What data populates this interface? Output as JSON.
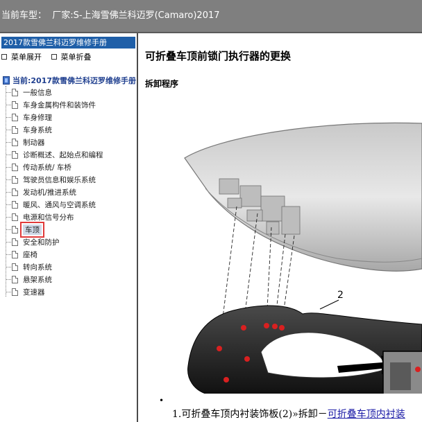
{
  "header": {
    "vehicle_label": "当前车型：",
    "vehicle_value": "厂家:S-上海雪佛兰科迈罗(Camaro)2017"
  },
  "sidebar": {
    "manual_title": "2017款雪佛兰科迈罗维修手册",
    "expand_label": "菜单展开",
    "collapse_label": "菜单折叠",
    "current_label": "当前:2017款雪佛兰科迈罗维修手册",
    "items": [
      {
        "label": "一般信息"
      },
      {
        "label": "车身金属构件和装饰件"
      },
      {
        "label": "车身修理"
      },
      {
        "label": "车身系统"
      },
      {
        "label": "制动器"
      },
      {
        "label": "诊断概述、起始点和编程"
      },
      {
        "label": "传动系统/ 车桥"
      },
      {
        "label": "驾驶员信息和娱乐系统"
      },
      {
        "label": "发动机/推进系统"
      },
      {
        "label": "暖风、通风与空调系统"
      },
      {
        "label": "电源和信号分布"
      },
      {
        "label": "车顶"
      },
      {
        "label": "安全和防护"
      },
      {
        "label": "座椅"
      },
      {
        "label": "转向系统"
      },
      {
        "label": "悬架系统"
      },
      {
        "label": "变速器"
      }
    ],
    "selected_index": 11
  },
  "content": {
    "title": "可折叠车顶前锁门执行器的更换",
    "section": "拆卸程序",
    "figure_callout": "2",
    "bullet": "•",
    "step_text": "1.可折叠车顶内衬装饰板(2)»拆卸－",
    "step_link": "可折叠车顶内衬装"
  },
  "colors": {
    "header_bg": "#7f7f7f",
    "manual_title_bg": "#1f5fa8",
    "selected_outline": "#e03a3a",
    "link": "#1a1aa6"
  }
}
